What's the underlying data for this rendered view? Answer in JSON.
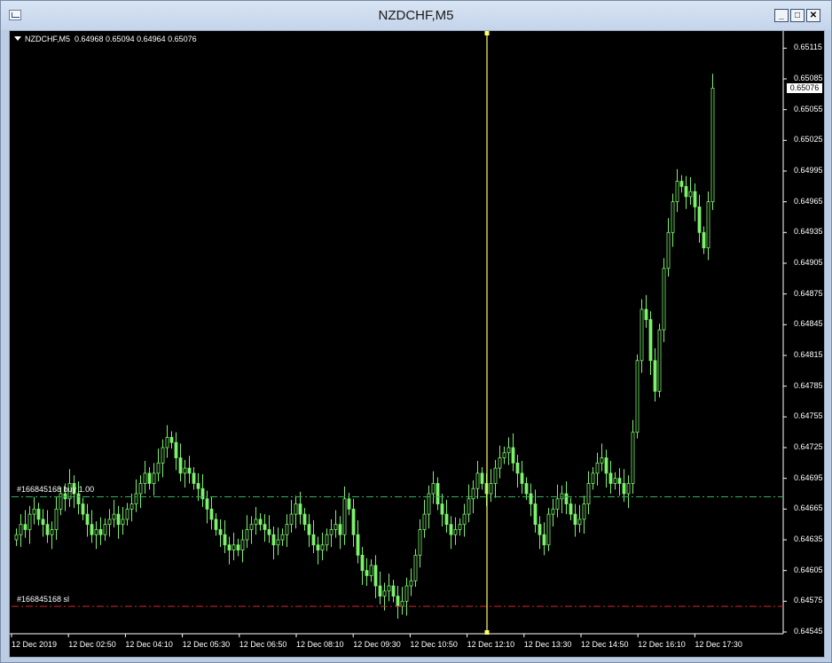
{
  "window": {
    "title": "NZDCHF,M5"
  },
  "chart_header": {
    "symbol": "NZDCHF,M5",
    "ohlc": "0.64968 0.65094 0.64964 0.65076"
  },
  "colors": {
    "background": "#000000",
    "candle": "#7cf26c",
    "buy_line": "#32b45a",
    "sl_line": "#d22828",
    "vline": "#ffff66",
    "text": "#ffffff"
  },
  "orders": {
    "buy_label": "#166845168 buy 1.00",
    "sl_label": "#166845168 sl"
  },
  "current_price": "0.65076",
  "chart_data": {
    "type": "candlestick",
    "title": "",
    "y_ticks": [
      "0.65115",
      "0.65085",
      "0.65055",
      "0.65025",
      "0.64995",
      "0.64965",
      "0.64935",
      "0.64905",
      "0.64875",
      "0.64845",
      "0.64815",
      "0.64785",
      "0.64755",
      "0.64725",
      "0.64695",
      "0.64665",
      "0.64635",
      "0.64605",
      "0.64575",
      "0.64545"
    ],
    "x_ticks": [
      "12 Dec 2019",
      "12 Dec 02:50",
      "12 Dec 04:10",
      "12 Dec 05:30",
      "12 Dec 06:50",
      "12 Dec 08:10",
      "12 Dec 09:30",
      "12 Dec 10:50",
      "12 Dec 12:10",
      "12 Dec 13:30",
      "12 Dec 14:50",
      "12 Dec 16:10",
      "12 Dec 17:30"
    ],
    "ylim": [
      0.64545,
      0.6513
    ],
    "buy_price": 0.64677,
    "sl_price": 0.6457,
    "closes": [
      0.6464,
      0.6465,
      0.64645,
      0.6466,
      0.64665,
      0.64655,
      0.6465,
      0.6464,
      0.64645,
      0.64665,
      0.6468,
      0.64675,
      0.6469,
      0.6468,
      0.6467,
      0.6466,
      0.6465,
      0.6464,
      0.64645,
      0.6464,
      0.6465,
      0.64655,
      0.6466,
      0.6465,
      0.64655,
      0.64665,
      0.6467,
      0.6468,
      0.6469,
      0.647,
      0.6469,
      0.647,
      0.6471,
      0.64725,
      0.64735,
      0.6473,
      0.64715,
      0.647,
      0.64705,
      0.647,
      0.6469,
      0.64685,
      0.64675,
      0.64665,
      0.64655,
      0.64645,
      0.6464,
      0.6463,
      0.64625,
      0.6463,
      0.64625,
      0.64635,
      0.64645,
      0.6465,
      0.64655,
      0.6465,
      0.64645,
      0.6464,
      0.6463,
      0.64635,
      0.6464,
      0.6465,
      0.6466,
      0.6467,
      0.6466,
      0.6465,
      0.6464,
      0.6463,
      0.64625,
      0.6463,
      0.6464,
      0.64645,
      0.6465,
      0.6464,
      0.64675,
      0.64665,
      0.6464,
      0.6462,
      0.64605,
      0.646,
      0.6461,
      0.6459,
      0.6458,
      0.64585,
      0.6459,
      0.6458,
      0.6457,
      0.64575,
      0.6459,
      0.64595,
      0.6462,
      0.64645,
      0.6466,
      0.6468,
      0.6469,
      0.6467,
      0.6466,
      0.6465,
      0.6464,
      0.64645,
      0.6465,
      0.6466,
      0.64675,
      0.64685,
      0.647,
      0.6469,
      0.6468,
      0.6469,
      0.64705,
      0.64715,
      0.6472,
      0.64725,
      0.6471,
      0.647,
      0.6469,
      0.6468,
      0.6467,
      0.6465,
      0.6464,
      0.6463,
      0.6466,
      0.64665,
      0.64675,
      0.6468,
      0.6467,
      0.6466,
      0.6465,
      0.64655,
      0.6467,
      0.6469,
      0.647,
      0.6471,
      0.64715,
      0.647,
      0.6469,
      0.64695,
      0.6469,
      0.6468,
      0.6469,
      0.6474,
      0.6481,
      0.6486,
      0.6485,
      0.6481,
      0.6478,
      0.6484,
      0.649,
      0.64935,
      0.64965,
      0.64985,
      0.6498,
      0.6497,
      0.64975,
      0.6496,
      0.64935,
      0.6492,
      0.64965,
      0.65076
    ]
  }
}
